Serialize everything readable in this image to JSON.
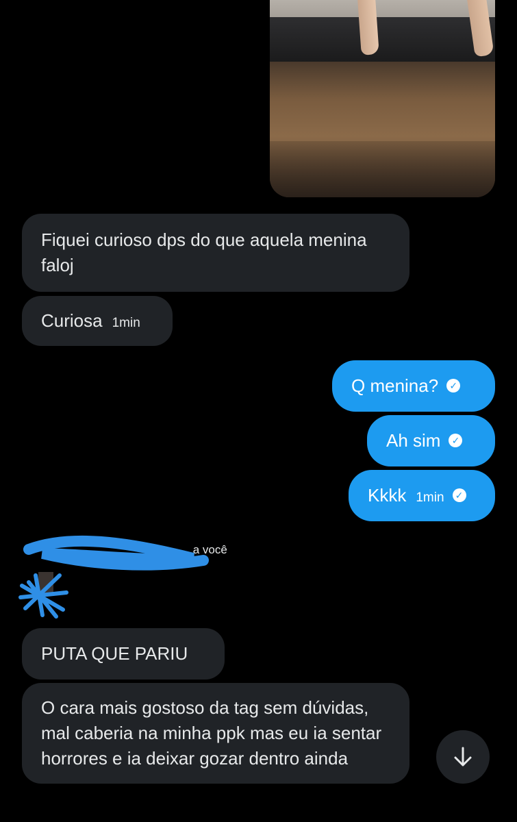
{
  "messages": {
    "received_1": "Fiquei curioso dps do que aquela menina faloj",
    "received_2": "Curiosa",
    "received_2_time": "1min",
    "sent_1": "Q menina?",
    "sent_2": "Ah sim",
    "sent_3": "Kkkk",
    "sent_3_time": "1min",
    "replied_label": "a você",
    "received_3": "PUTA  QUE PARIU",
    "received_4": "O cara mais gostoso da tag sem dúvidas, mal caberia na minha ppk mas eu ia sentar horrores e ia deixar gozar dentro ainda"
  },
  "icons": {
    "sent_check": "check-circle-icon",
    "scroll_down": "arrow-down-icon",
    "reply_arrow": "arrow-left-icon"
  },
  "colors": {
    "background": "#000000",
    "incoming_bubble": "#202327",
    "outgoing_bubble": "#1d9bf0",
    "redaction": "#2f8fe6"
  }
}
